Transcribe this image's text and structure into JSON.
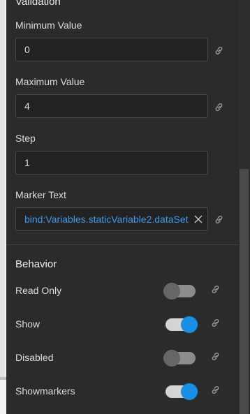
{
  "validation": {
    "title": "Validation",
    "min_label": "Minimum Value",
    "min_value": "0",
    "max_label": "Maximum Value",
    "max_value": "4",
    "step_label": "Step",
    "step_value": "1",
    "marker_label": "Marker Text",
    "marker_value": "bind:Variables.staticVariable2.dataSet"
  },
  "behavior": {
    "title": "Behavior",
    "items": [
      {
        "label": "Read Only",
        "on": false
      },
      {
        "label": "Show",
        "on": true
      },
      {
        "label": "Disabled",
        "on": false
      },
      {
        "label": "Showmarkers",
        "on": true
      }
    ]
  },
  "icons": {
    "link": "link-icon",
    "clear": "close-icon"
  },
  "colors": {
    "accent": "#1a8ee6",
    "bound_text": "#3f9bea"
  }
}
